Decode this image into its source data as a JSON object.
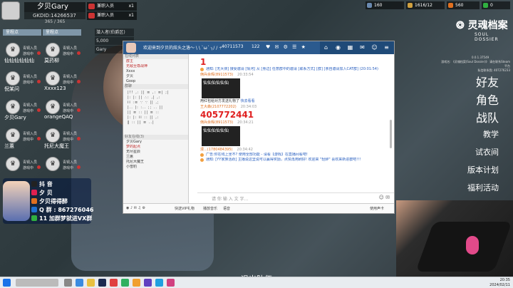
{
  "hud": {
    "player_name": "夕贝Gary",
    "player_id": "GKDID:14266537",
    "hp": "365 / 365",
    "badges": [
      {
        "label": "兼职入员",
        "count": "x1"
      },
      {
        "label": "兼职入员",
        "count": "x1"
      }
    ],
    "team_header": "里程点",
    "card_info": [
      "潜入者(伯爵区)",
      "5,000",
      "Gary"
    ]
  },
  "players": [
    {
      "name": "仙仙仙仙仙仙",
      "level": "青铜入员",
      "status": "游戏中"
    },
    {
      "name": "莫药柳",
      "level": "青铜入员",
      "status": "游戏中"
    },
    {
      "name": "倪某问",
      "level": "青铜入员",
      "status": "游戏中"
    },
    {
      "name": "Xxxx123",
      "level": "青铜入员",
      "status": "游戏中"
    },
    {
      "name": "夕贝Gary",
      "level": "青铜入员",
      "status": "游戏中"
    },
    {
      "name": "orangeQAQ",
      "level": "青铜入员",
      "status": "游戏中"
    },
    {
      "name": "兰蕙",
      "level": "青铜入员",
      "status": "游戏中"
    },
    {
      "name": "托尼大魔王",
      "level": "青铜入员",
      "status": "游戏中"
    },
    {
      "name": "",
      "level": "青铜入员",
      "status": "游戏中"
    },
    {
      "name": "",
      "level": "青铜入员",
      "status": "游戏中"
    }
  ],
  "stream": {
    "lines": [
      "抖 音",
      "夕 贝",
      "夕贝得得醉",
      "Q 群 : 867276046",
      "11 加群梦就进VX群"
    ],
    "line_colors": [
      "#222222",
      "#e02050",
      "#e07020",
      "#2070d0",
      "#30b040"
    ]
  },
  "chat": {
    "title": "欢迎来到夕贝的炫头之洛～ \\ \\ `ω´ ╮/ / ÷",
    "room_id": "40711573",
    "viewers": "122",
    "sidebar": {
      "rows": [
        "群主",
        "无敌至尊战神",
        "Xxxx",
        "夕贝",
        "Goop"
      ],
      "section1": "在线列表",
      "section2": "群聊",
      "section3": "好友在线(3)",
      "friends": [
        "夕贝Gary",
        "梦的起点",
        "无尽星辰",
        "兰蕙",
        "托尼大魔王",
        "小雪豹"
      ]
    },
    "messages": {
      "big1": "1",
      "sys1": "通知: [无大侠] 接受邀请 [情河] 从 [身边] 任意群中的邀请 [联系方式] [群] [亲自邀请加入CAT群] (20:01:54)",
      "name1": "佣兵余晖(8911573)",
      "time1": "20:33:54",
      "img1": "仙仙仙仙仙仙",
      "note1": "用红包给对方发送礼物了",
      "note1_link": "快去看看",
      "name2": "王大森(2107772202)",
      "time2": "20:34:03",
      "big2": "405772441",
      "name3": "佣兵余晖(8911573)",
      "time3": "20:34:21",
      "img2": "仙仙仙仙仙仙",
      "name4": "漫...(1780484395)",
      "time4": "20:34:42",
      "sys2": "广告:你在线上坐不?  使用全部功能 - 请看【游戏】在直播间看吧!",
      "sys3": "通知: [YY家族活跃] 主播说这里说可以赢得奖励，点赞再用刷好!  欢迎来 \"轻醉\" 喜欢来新进群吧!!!"
    },
    "input_placeholder": "请 你 输 入 文 字...",
    "bottom": [
      "发言",
      "快捷语",
      "快送VIP礼物",
      "播放音乐",
      "语音",
      "使用声卡"
    ]
  },
  "top_stats": [
    {
      "value": "160",
      "color": "#6a8ab0"
    },
    {
      "value": "1616/12",
      "color": "#d0a040"
    },
    {
      "value": "560",
      "color": "#e07020"
    },
    {
      "value": "0",
      "color": "#30b040"
    }
  ],
  "logo": {
    "title": "灵魂档案",
    "subtitle": "SOUL DOSSIER"
  },
  "version": "0.0.1.37549",
  "game_info": [
    "游戏名: 《灵魂档案(Soul Dossier)》 请在联系Steam平台",
    "私信联系我: 407276233"
  ],
  "menu": [
    "好友",
    "角色",
    "战队",
    "教学",
    "试衣间",
    "版本计划",
    "福利活动"
  ],
  "exit_button": "退出队伍",
  "clock": {
    "time": "20:35",
    "date": "2024/02/11"
  }
}
